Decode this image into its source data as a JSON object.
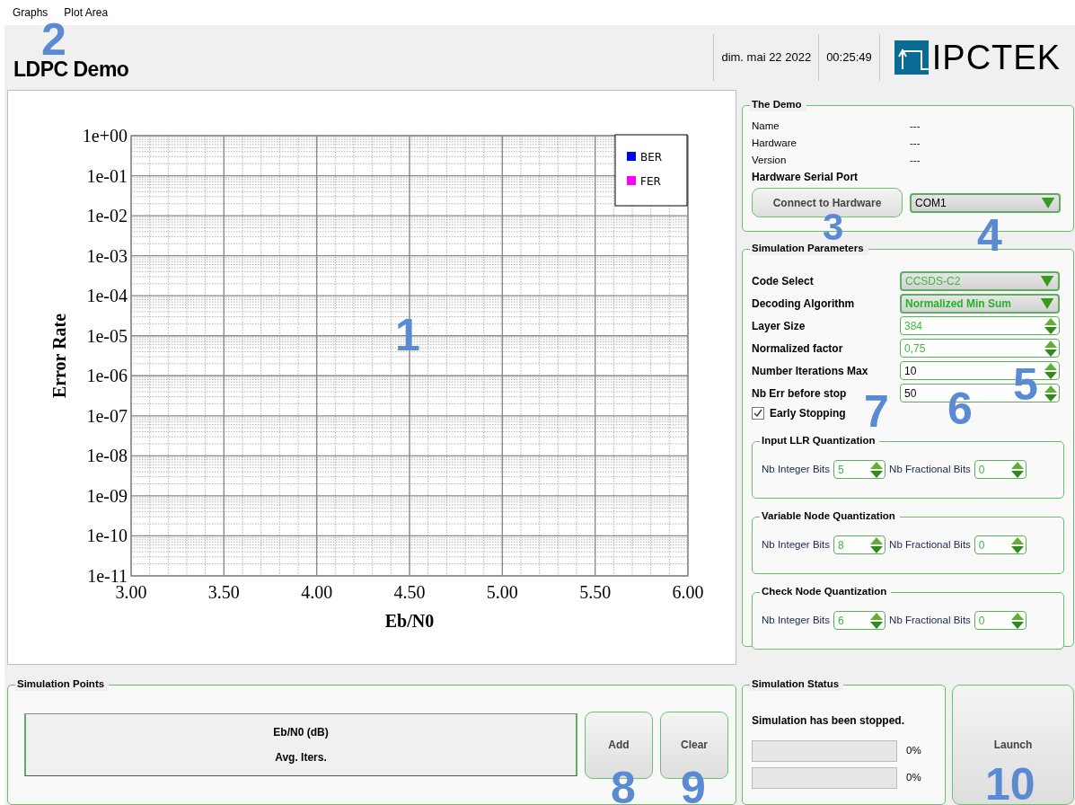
{
  "menu": [
    {
      "label": "Graphs"
    },
    {
      "label": "Plot Area"
    }
  ],
  "title": "LDPC Demo",
  "header": {
    "date": "dim. mai 22 2022",
    "time": "00:25:49",
    "logo_text": "IPCTEK"
  },
  "plot": {
    "x_axis_title": "Eb/N0",
    "y_axis_title": "Error Rate",
    "x_tick_labels": [
      "3.00",
      "3.50",
      "4.00",
      "4.50",
      "5.00",
      "5.50",
      "6.00"
    ],
    "y_tick_labels": [
      "1e+00",
      "1e-01",
      "1e-02",
      "1e-03",
      "1e-04",
      "1e-05",
      "1e-06",
      "1e-07",
      "1e-08",
      "1e-09",
      "1e-10",
      "1e-11"
    ],
    "legend": [
      {
        "name": "BER",
        "color": "#0000ff"
      },
      {
        "name": "FER",
        "color": "#ff00ff"
      }
    ]
  },
  "demo": {
    "title": "The Demo",
    "info": [
      {
        "label": "Name",
        "value": "---"
      },
      {
        "label": "Hardware",
        "value": "---"
      },
      {
        "label": "Version",
        "value": "---"
      }
    ],
    "serial_port_label": "Hardware Serial Port",
    "connect_button": "Connect to Hardware",
    "port_select": {
      "value": "COM1"
    }
  },
  "params": {
    "title": "Simulation Parameters",
    "rows": [
      {
        "kind": "select",
        "label": "Code Select",
        "value": "CCSDS-C2",
        "color": "#3cb83c",
        "bold": false
      },
      {
        "kind": "select",
        "label": "Decoding Algorithm",
        "value": "Normalized Min Sum",
        "color": "#22b422",
        "bold": true
      },
      {
        "kind": "spin",
        "label": "Layer Size",
        "value": "384",
        "color": "#3cb83c"
      },
      {
        "kind": "spin",
        "label": "Normalized factor",
        "value": "0,75",
        "color": "#3cb83c"
      },
      {
        "kind": "spin",
        "label": "Number Iterations Max",
        "value": "10",
        "color": "#000000"
      },
      {
        "kind": "spin",
        "label": "Nb Err before stop",
        "value": "50",
        "color": "#000000"
      }
    ],
    "early_stopping": {
      "label": "Early Stopping",
      "checked": true
    },
    "quantization": [
      {
        "title": "Input LLR Quantization",
        "fields": [
          {
            "label": "Nb Integer Bits",
            "value": "5"
          },
          {
            "label": "Nb Fractional Bits",
            "value": "0"
          }
        ]
      },
      {
        "title": "Variable Node Quantization",
        "fields": [
          {
            "label": "Nb Integer Bits",
            "value": "8"
          },
          {
            "label": "Nb Fractional Bits",
            "value": "0"
          }
        ]
      },
      {
        "title": "Check Node Quantization",
        "fields": [
          {
            "label": "Nb Integer Bits",
            "value": "6"
          },
          {
            "label": "Nb Fractional Bits",
            "value": "0"
          }
        ]
      }
    ]
  },
  "sim_points": {
    "title": "Simulation Points",
    "columns": [
      "Eb/N0 (dB)",
      "Avg. Iters."
    ],
    "buttons": [
      {
        "label": "Add"
      },
      {
        "label": "Clear"
      }
    ]
  },
  "status": {
    "title": "Simulation Status",
    "message": "Simulation has been stopped.",
    "bars": [
      {
        "level": 0,
        "reading": "0%"
      },
      {
        "level": 0,
        "reading": "0%"
      }
    ]
  },
  "launch_button": "Launch",
  "callouts": [
    {
      "label": "1"
    },
    {
      "label": "2"
    },
    {
      "label": "3"
    },
    {
      "label": "4"
    },
    {
      "label": "5"
    },
    {
      "label": "6"
    },
    {
      "label": "7"
    },
    {
      "label": "8"
    },
    {
      "label": "9"
    },
    {
      "label": "10"
    }
  ]
}
